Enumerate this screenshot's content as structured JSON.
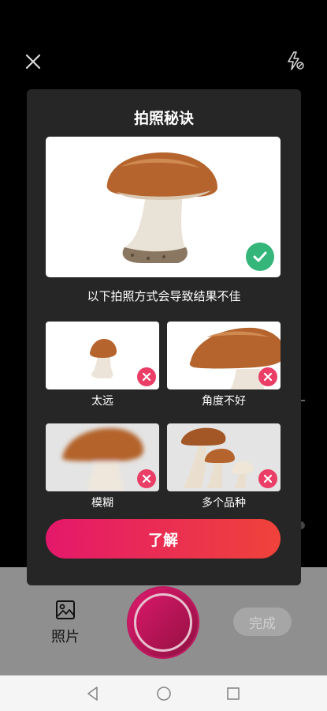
{
  "dialog": {
    "title": "拍照秘诀",
    "subtitle": "以下拍照方式会导致结果不佳",
    "tips": [
      {
        "label": "太远"
      },
      {
        "label": "角度不好"
      },
      {
        "label": "模糊"
      },
      {
        "label": "多个品种"
      }
    ],
    "learn_button": "了解"
  },
  "bottom": {
    "photo_label": "照片",
    "done_label": "完成"
  },
  "icons": {
    "close": "close-icon",
    "flash": "flash-off-icon",
    "gallery": "image-icon",
    "check": "check-icon",
    "cross": "cross-icon",
    "back": "back-triangle-icon",
    "home": "home-circle-icon",
    "recents": "recents-square-icon"
  },
  "colors": {
    "accent_start": "#e4186b",
    "accent_end": "#f0433a",
    "good": "#34b57a",
    "bad": "#ea3e67"
  }
}
